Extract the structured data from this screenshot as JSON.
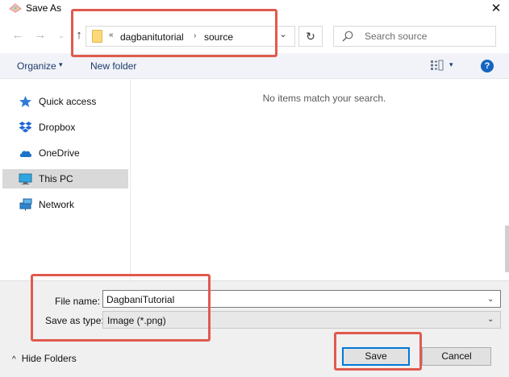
{
  "window": {
    "title": "Save As",
    "close_glyph": "✕",
    "icon": "app-logo-icon"
  },
  "navigation": {
    "back_glyph": "←",
    "forward_glyph": "→",
    "recent_glyph": "⌄",
    "up_glyph": "↑",
    "breadcrumb": {
      "overflow": "«",
      "items": [
        "dagbanitutorial",
        "source"
      ],
      "separator": "›"
    },
    "dropdown_glyph": "⌄",
    "refresh_glyph": "↻"
  },
  "search": {
    "placeholder": "Search source"
  },
  "toolbar": {
    "organize_label": "Organize",
    "organize_caret": "▾",
    "new_folder_label": "New folder",
    "view_caret": "▾",
    "help_label": "?"
  },
  "sidebar": {
    "items": [
      {
        "label": "Quick access",
        "icon": "star-icon"
      },
      {
        "label": "Dropbox",
        "icon": "dropbox-icon"
      },
      {
        "label": "OneDrive",
        "icon": "cloud-icon"
      },
      {
        "label": "This PC",
        "icon": "monitor-icon",
        "selected": true
      },
      {
        "label": "Network",
        "icon": "network-icon"
      }
    ]
  },
  "content": {
    "empty_message": "No items match your search."
  },
  "form": {
    "file_name_label": "File name:",
    "file_name_value": "DagbaniTutorial",
    "save_type_label": "Save as type:",
    "save_type_value": "Image (*.png)",
    "caret": "⌄"
  },
  "footer": {
    "hide_folders_caret": "^",
    "hide_folders_label": "Hide Folders",
    "save_label": "Save",
    "cancel_label": "Cancel"
  },
  "colors": {
    "highlight": "#e05a4e",
    "accent": "#0078d7",
    "link_text": "#1d3a6b",
    "toolbar_bg": "#f1f3f8"
  }
}
